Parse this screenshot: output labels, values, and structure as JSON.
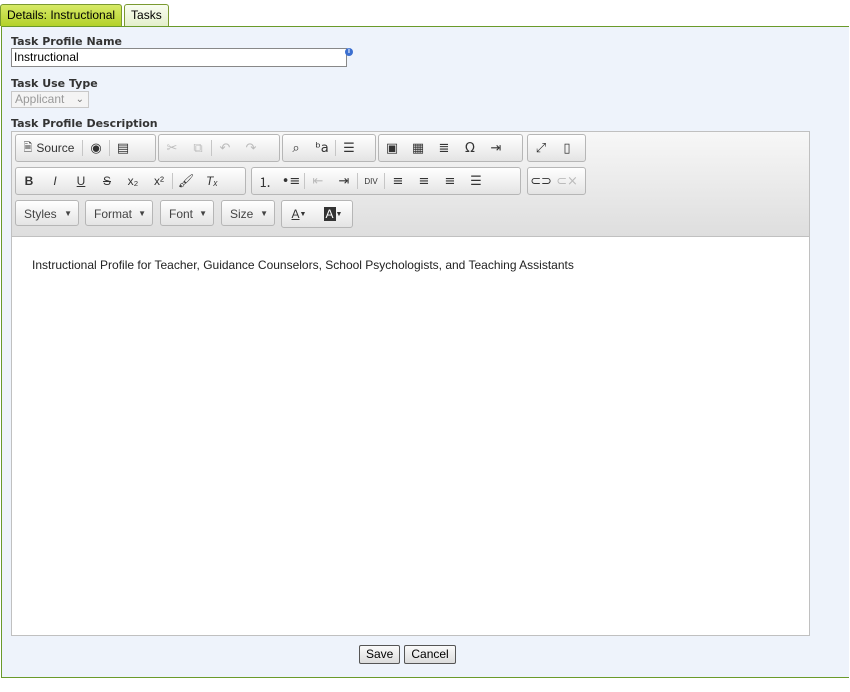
{
  "tabs": [
    {
      "label": "Details: Instructional",
      "active": true
    },
    {
      "label": "Tasks",
      "active": false
    }
  ],
  "form": {
    "profile_name_label": "Task Profile Name",
    "profile_name_value": "Instructional",
    "use_type_label": "Task Use Type",
    "use_type_value": "Applicant",
    "description_label": "Task Profile Description"
  },
  "editor": {
    "source_label": "Source",
    "styles_label": "Styles",
    "format_label": "Format",
    "font_label": "Font",
    "size_label": "Size",
    "content_text": "Instructional Profile for Teacher, Guidance Counselors, School Psychologists, and Teaching Assistants"
  },
  "actions": {
    "save_label": "Save",
    "cancel_label": "Cancel"
  },
  "colors": {
    "active_tab": "#c5de48",
    "panel_bg": "#eef3fb",
    "panel_border": "#6a9a2a"
  }
}
